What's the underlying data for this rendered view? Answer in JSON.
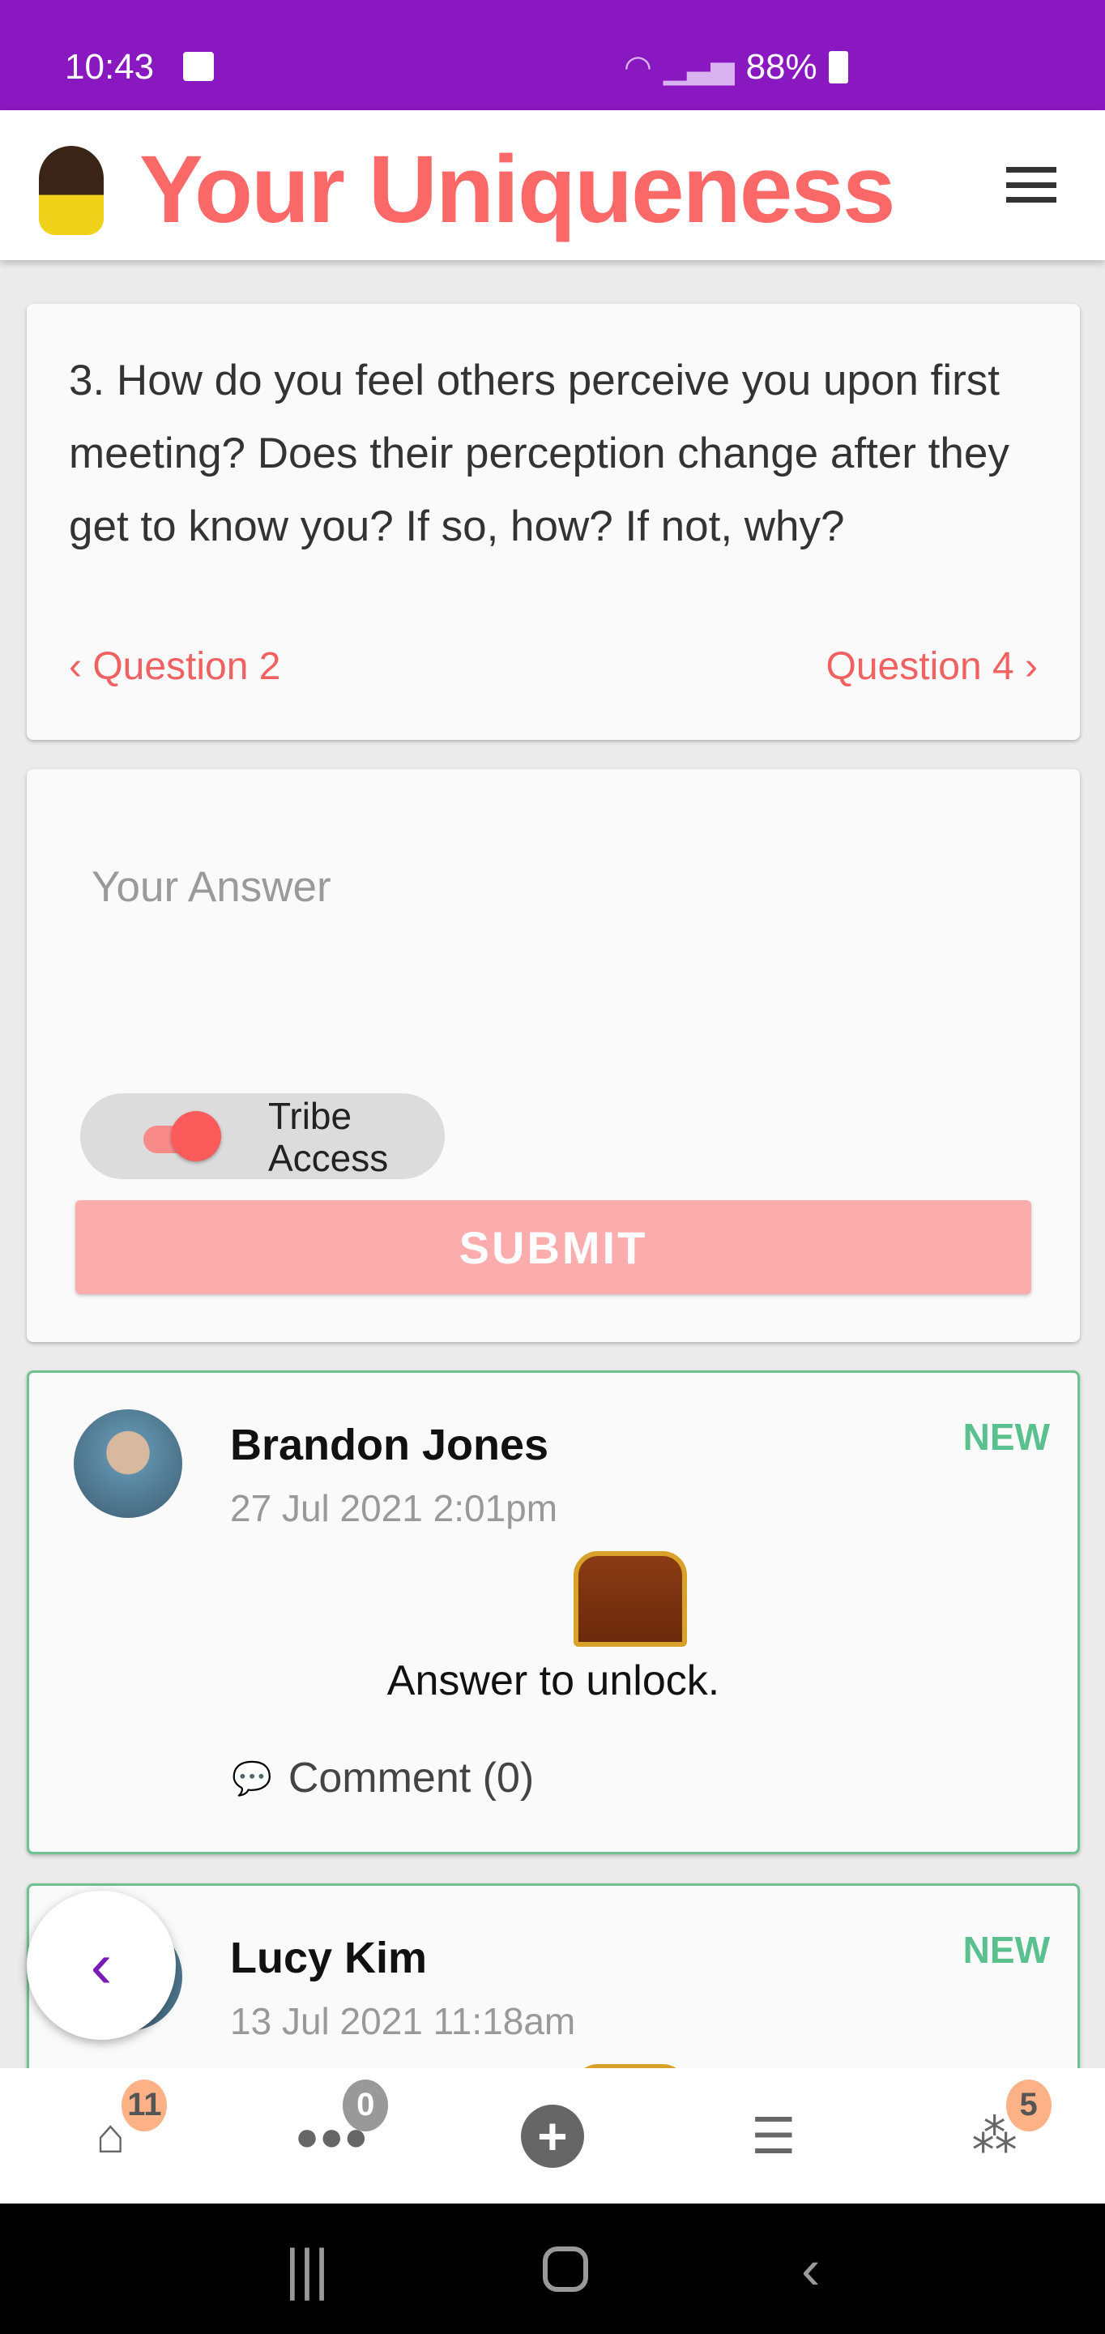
{
  "status_bar": {
    "time": "10:43",
    "battery": "88%"
  },
  "header": {
    "title": "Your Uniqueness",
    "menu_icon": "hamburger-icon"
  },
  "question": {
    "text": "3. How do you feel others perceive you upon first meeting? Does their perception change after they get to know you? If so, how? If not, why?",
    "prev_label": "Question 2",
    "next_label": "Question 4"
  },
  "answer_form": {
    "placeholder": "Your Answer",
    "toggle_label": "Tribe Access",
    "toggle_on": true,
    "submit_label": "SUBMIT"
  },
  "posts": [
    {
      "name": "Brandon Jones",
      "date": "27 Jul 2021 2:01pm",
      "badge": "NEW",
      "locked_text": "Answer to unlock.",
      "comment_label": "Comment (0)"
    },
    {
      "name": "Lucy Kim",
      "date": "13 Jul 2021 11:18am",
      "badge": "NEW"
    }
  ],
  "bottom_nav": {
    "items": [
      {
        "icon": "home-icon",
        "badge": "11"
      },
      {
        "icon": "users-icon",
        "badge": "0"
      },
      {
        "icon": "plus-circle-icon"
      },
      {
        "icon": "list-icon"
      },
      {
        "icon": "network-icon",
        "badge": "5"
      }
    ]
  },
  "colors": {
    "accent": "#fb6868",
    "status_bar": "#8a18c0",
    "new_badge": "#5ac18e"
  }
}
